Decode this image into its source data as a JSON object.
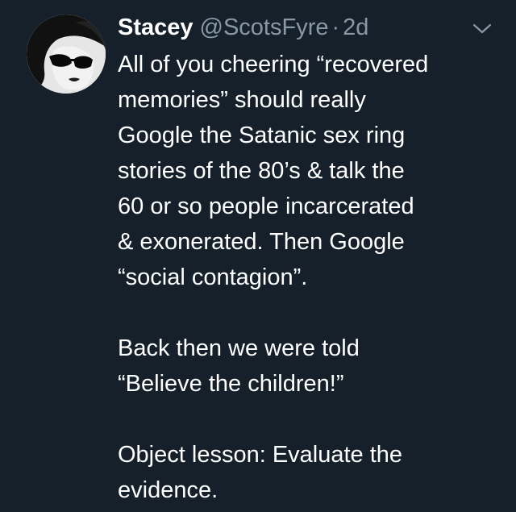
{
  "tweet": {
    "author": {
      "display_name": "Stacey",
      "handle": "@ScotsFyre",
      "separator": "·",
      "timestamp": "2d"
    },
    "menu_icon": "chevron-down-icon",
    "paragraphs": [
      {
        "lines": [
          "All of you cheering “recovered",
          "memories” should really",
          "Google the Satanic sex ring",
          "stories of the 80’s & talk the",
          "60 or so people incarcerated",
          "& exonerated. Then Google",
          "“social contagion”."
        ]
      },
      {
        "lines": [
          "Back then we were told",
          "“Believe the children!”"
        ]
      },
      {
        "lines": [
          "Object lesson: Evaluate the",
          "evidence."
        ]
      }
    ]
  },
  "colors": {
    "background": "#15202b",
    "primary_text": "#ffffff",
    "secondary_text": "#8899a6"
  }
}
